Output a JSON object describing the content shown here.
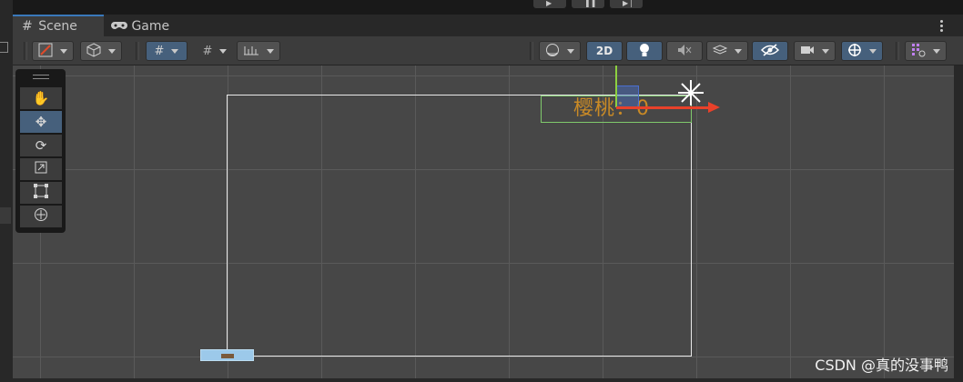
{
  "tabs": [
    {
      "label": "Scene",
      "icon": "grid-icon",
      "active": true
    },
    {
      "label": "Game",
      "icon": "gamepad-icon",
      "active": false
    }
  ],
  "playbar": {
    "play": "▶",
    "pause": "❚❚",
    "step": "▶❘"
  },
  "toolbar": {
    "view2d_label": "2D",
    "icons": [
      "draw-mode-icon",
      "shading-cube-icon",
      "grid-snap-icon",
      "increment-snap-icon",
      "ruler-icon",
      "render-mode-icon",
      "lighting-icon",
      "audio-icon",
      "effects-icon",
      "visibility-icon",
      "camera-icon",
      "gizmo-icon",
      "layers-icon"
    ]
  },
  "tools": [
    "hand-tool",
    "move-tool",
    "rotate-tool",
    "scale-tool",
    "rect-tool",
    "transform-tool"
  ],
  "scene": {
    "text_object": "樱桃：0"
  },
  "watermark": "CSDN @真的没事鸭",
  "colors": {
    "accent": "#3a79bb",
    "selected": "#46607c",
    "text_color": "#c98a26",
    "x_axis": "#e8412a",
    "y_axis": "#8dd040"
  }
}
